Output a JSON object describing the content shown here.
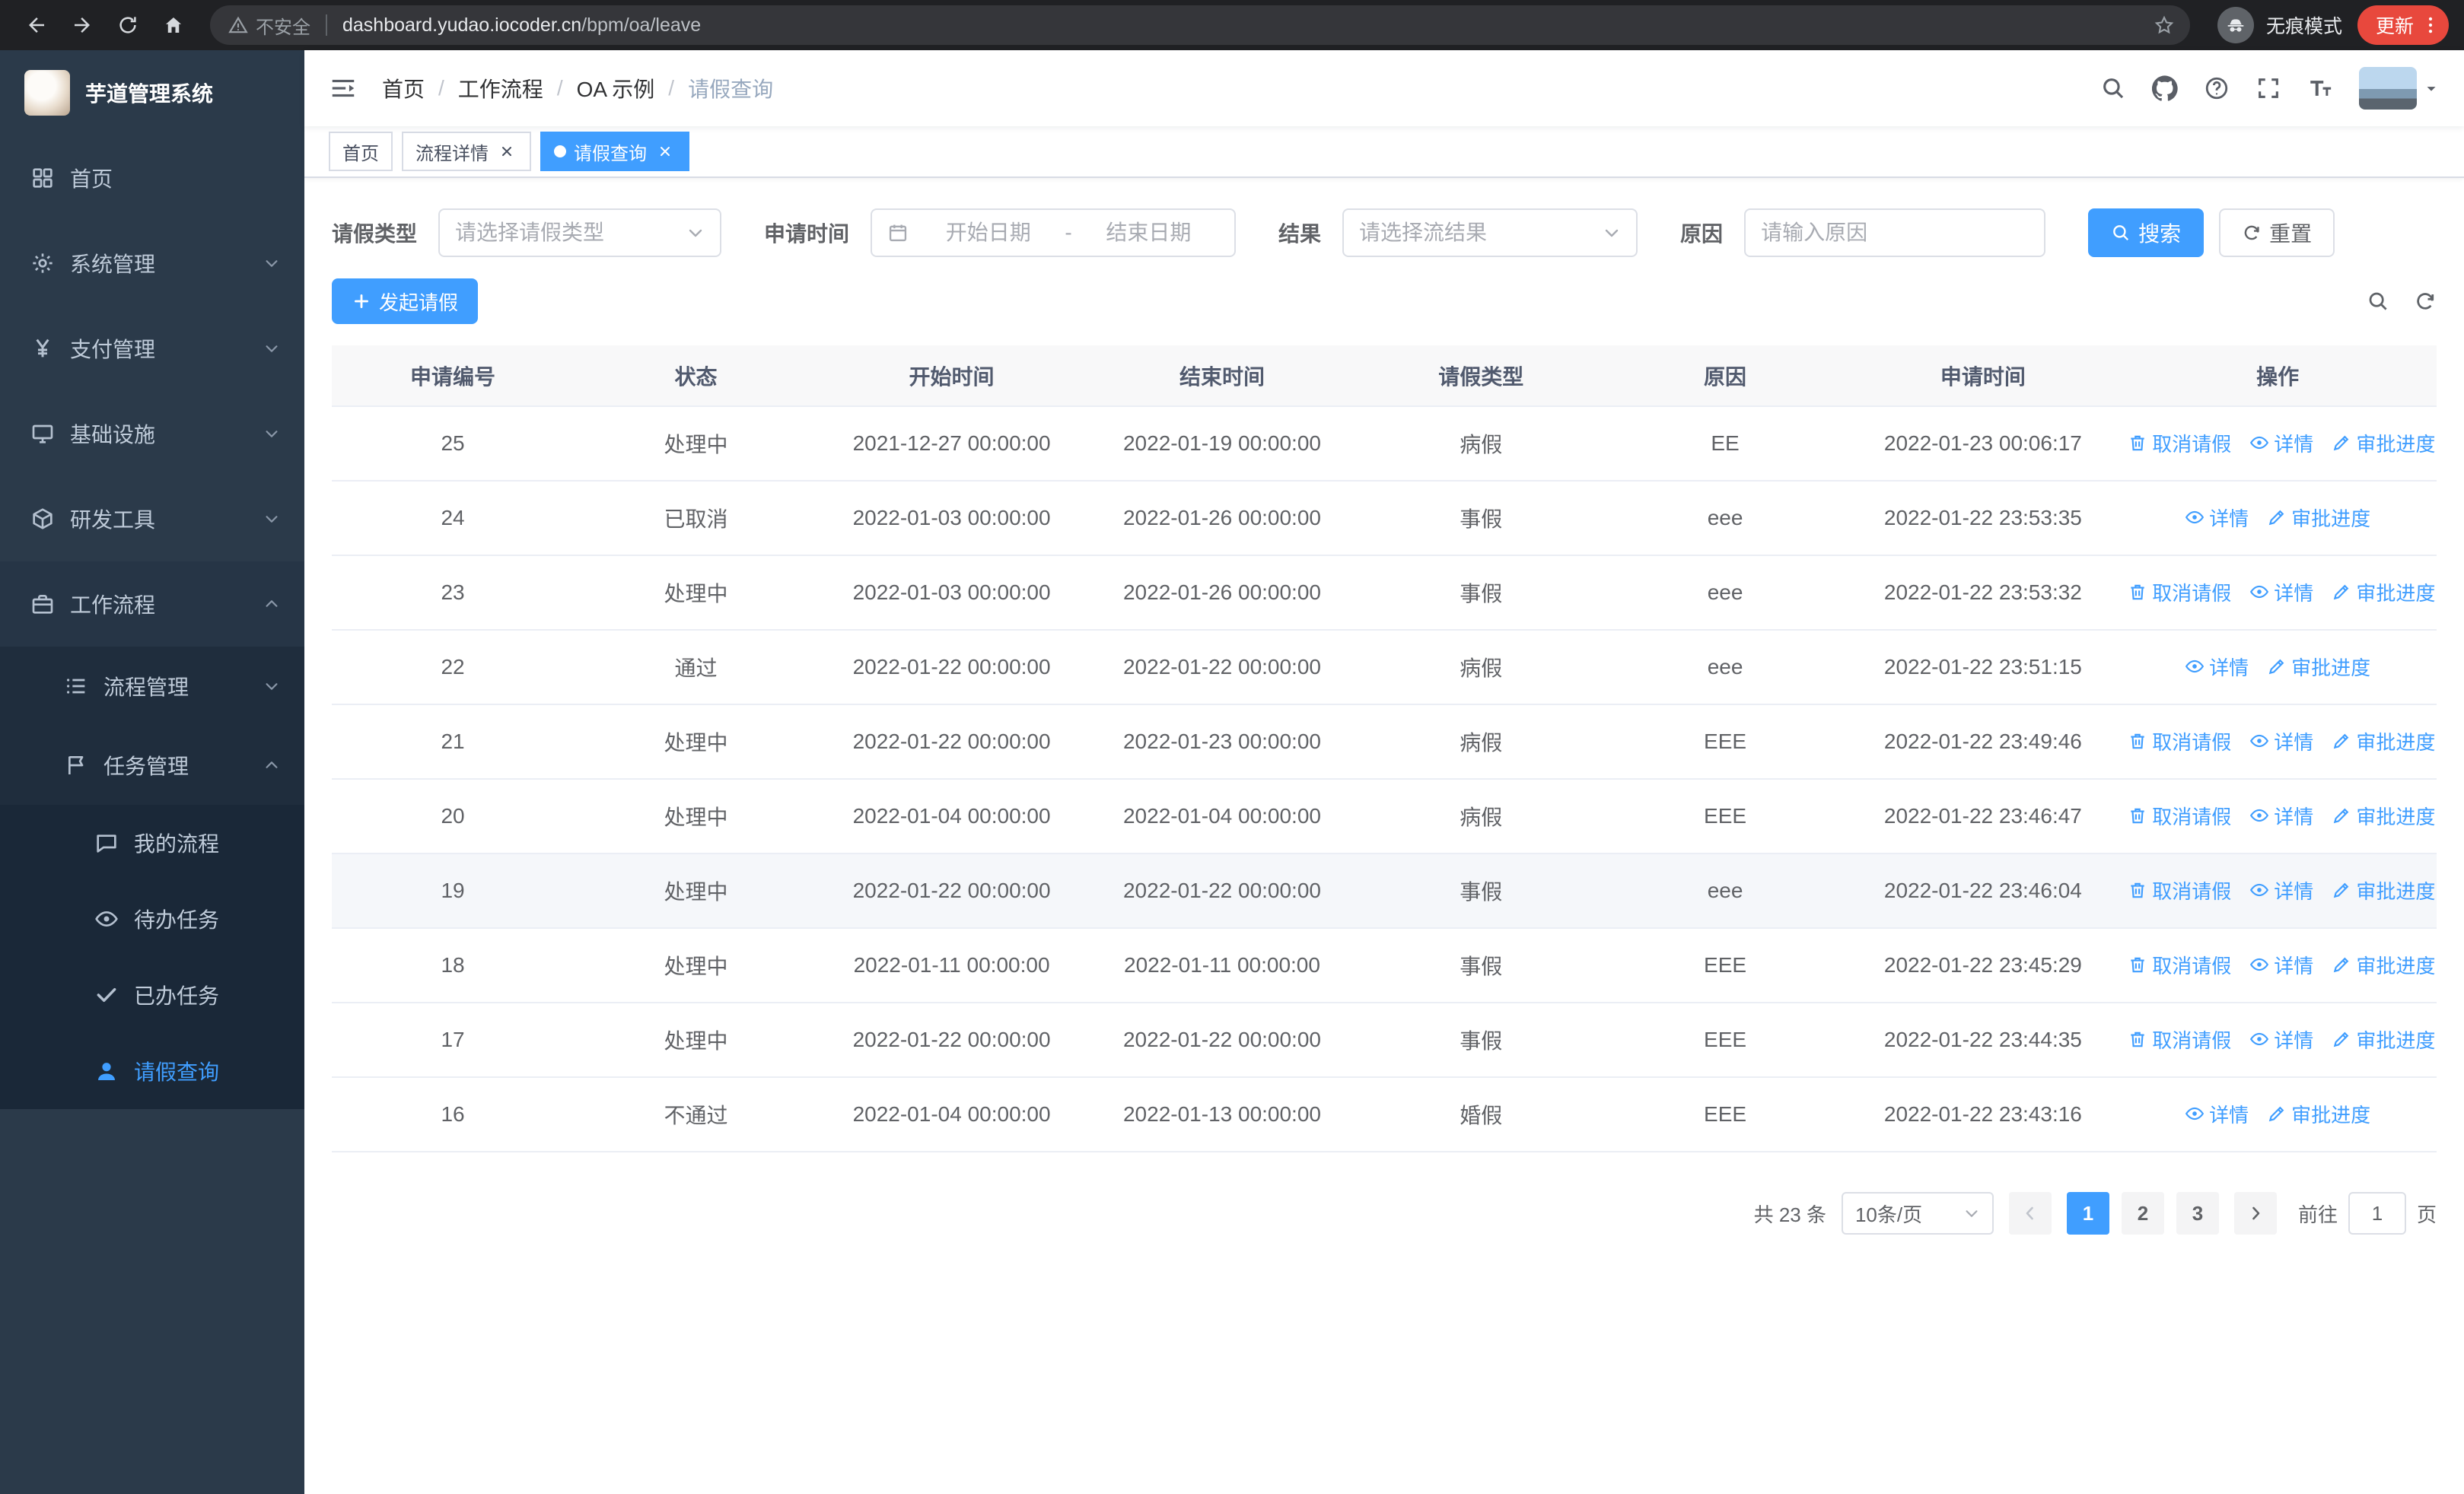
{
  "browser": {
    "security_warning": "不安全",
    "url_domain": "dashboard.yudao.iocoder.cn",
    "url_path": "/bpm/oa/leave",
    "incognito_label": "无痕模式",
    "update_label": "更新"
  },
  "sidebar": {
    "logo_title": "芋道管理系统",
    "menu": [
      {
        "key": "home",
        "label": "首页",
        "icon": "dashboard",
        "level": 1
      },
      {
        "key": "system",
        "label": "系统管理",
        "icon": "gear",
        "level": 1,
        "chevron": "down"
      },
      {
        "key": "payment",
        "label": "支付管理",
        "icon": "yen",
        "level": 1,
        "chevron": "down"
      },
      {
        "key": "infrastructure",
        "label": "基础设施",
        "icon": "monitor",
        "level": 1,
        "chevron": "down"
      },
      {
        "key": "devtools",
        "label": "研发工具",
        "icon": "cube",
        "level": 1,
        "chevron": "down"
      },
      {
        "key": "workflow",
        "label": "工作流程",
        "icon": "briefcase",
        "level": 1,
        "chevron": "up",
        "expanded": true
      },
      {
        "key": "process-management",
        "label": "流程管理",
        "icon": "list",
        "level": 2,
        "chevron": "down"
      },
      {
        "key": "task-management",
        "label": "任务管理",
        "icon": "flag",
        "level": 2,
        "chevron": "up",
        "expanded": true
      },
      {
        "key": "my-process",
        "label": "我的流程",
        "icon": "chat",
        "level": 3
      },
      {
        "key": "todo-tasks",
        "label": "待办任务",
        "icon": "eye",
        "level": 3
      },
      {
        "key": "done-tasks",
        "label": "已办任务",
        "icon": "check",
        "level": 3
      },
      {
        "key": "leave-query",
        "label": "请假查询",
        "icon": "user",
        "level": 3,
        "active": true
      }
    ]
  },
  "header": {
    "breadcrumb": [
      "首页",
      "工作流程",
      "OA 示例",
      "请假查询"
    ]
  },
  "tags": [
    {
      "key": "home",
      "label": "首页"
    },
    {
      "key": "process-detail",
      "label": "流程详情",
      "closable": true
    },
    {
      "key": "leave-query",
      "label": "请假查询",
      "closable": true,
      "active": true
    }
  ],
  "filters": {
    "leave_type_label": "请假类型",
    "leave_type_placeholder": "请选择请假类型",
    "apply_time_label": "申请时间",
    "date_start_placeholder": "开始日期",
    "date_separator": "-",
    "date_end_placeholder": "结束日期",
    "result_label": "结果",
    "result_placeholder": "请选择流结果",
    "reason_label": "原因",
    "reason_placeholder": "请输入原因",
    "search_button": "搜索",
    "reset_button": "重置"
  },
  "toolbar": {
    "create_button": "发起请假"
  },
  "table": {
    "headers": [
      "申请编号",
      "状态",
      "开始时间",
      "结束时间",
      "请假类型",
      "原因",
      "申请时间",
      "操作"
    ],
    "action_labels": {
      "cancel": "取消请假",
      "detail": "详情",
      "progress": "审批进度"
    },
    "rows": [
      {
        "id": "25",
        "status": "处理中",
        "start": "2021-12-27 00:00:00",
        "end": "2022-01-19 00:00:00",
        "type": "病假",
        "reason": "EE",
        "apply_time": "2022-01-23 00:06:17",
        "actions": [
          "cancel",
          "detail",
          "progress"
        ]
      },
      {
        "id": "24",
        "status": "已取消",
        "start": "2022-01-03 00:00:00",
        "end": "2022-01-26 00:00:00",
        "type": "事假",
        "reason": "eee",
        "apply_time": "2022-01-22 23:53:35",
        "actions": [
          "detail",
          "progress"
        ]
      },
      {
        "id": "23",
        "status": "处理中",
        "start": "2022-01-03 00:00:00",
        "end": "2022-01-26 00:00:00",
        "type": "事假",
        "reason": "eee",
        "apply_time": "2022-01-22 23:53:32",
        "actions": [
          "cancel",
          "detail",
          "progress"
        ]
      },
      {
        "id": "22",
        "status": "通过",
        "start": "2022-01-22 00:00:00",
        "end": "2022-01-22 00:00:00",
        "type": "病假",
        "reason": "eee",
        "apply_time": "2022-01-22 23:51:15",
        "actions": [
          "detail",
          "progress"
        ]
      },
      {
        "id": "21",
        "status": "处理中",
        "start": "2022-01-22 00:00:00",
        "end": "2022-01-23 00:00:00",
        "type": "病假",
        "reason": "EEE",
        "apply_time": "2022-01-22 23:49:46",
        "actions": [
          "cancel",
          "detail",
          "progress"
        ]
      },
      {
        "id": "20",
        "status": "处理中",
        "start": "2022-01-04 00:00:00",
        "end": "2022-01-04 00:00:00",
        "type": "病假",
        "reason": "EEE",
        "apply_time": "2022-01-22 23:46:47",
        "actions": [
          "cancel",
          "detail",
          "progress"
        ]
      },
      {
        "id": "19",
        "status": "处理中",
        "start": "2022-01-22 00:00:00",
        "end": "2022-01-22 00:00:00",
        "type": "事假",
        "reason": "eee",
        "apply_time": "2022-01-22 23:46:04",
        "actions": [
          "cancel",
          "detail",
          "progress"
        ],
        "hover": true
      },
      {
        "id": "18",
        "status": "处理中",
        "start": "2022-01-11 00:00:00",
        "end": "2022-01-11 00:00:00",
        "type": "事假",
        "reason": "EEE",
        "apply_time": "2022-01-22 23:45:29",
        "actions": [
          "cancel",
          "detail",
          "progress"
        ]
      },
      {
        "id": "17",
        "status": "处理中",
        "start": "2022-01-22 00:00:00",
        "end": "2022-01-22 00:00:00",
        "type": "事假",
        "reason": "EEE",
        "apply_time": "2022-01-22 23:44:35",
        "actions": [
          "cancel",
          "detail",
          "progress"
        ]
      },
      {
        "id": "16",
        "status": "不通过",
        "start": "2022-01-04 00:00:00",
        "end": "2022-01-13 00:00:00",
        "type": "婚假",
        "reason": "EEE",
        "apply_time": "2022-01-22 23:43:16",
        "actions": [
          "detail",
          "progress"
        ]
      }
    ]
  },
  "pagination": {
    "total_text": "共 23 条",
    "page_size": "10条/页",
    "pages": [
      "1",
      "2",
      "3"
    ],
    "current_page": "1",
    "goto_label": "前往",
    "goto_value": "1",
    "goto_unit": "页"
  },
  "colors": {
    "primary": "#409EFF",
    "sidebar_bg": "#2B3A4A",
    "update_button_bg": "#E8483D"
  }
}
